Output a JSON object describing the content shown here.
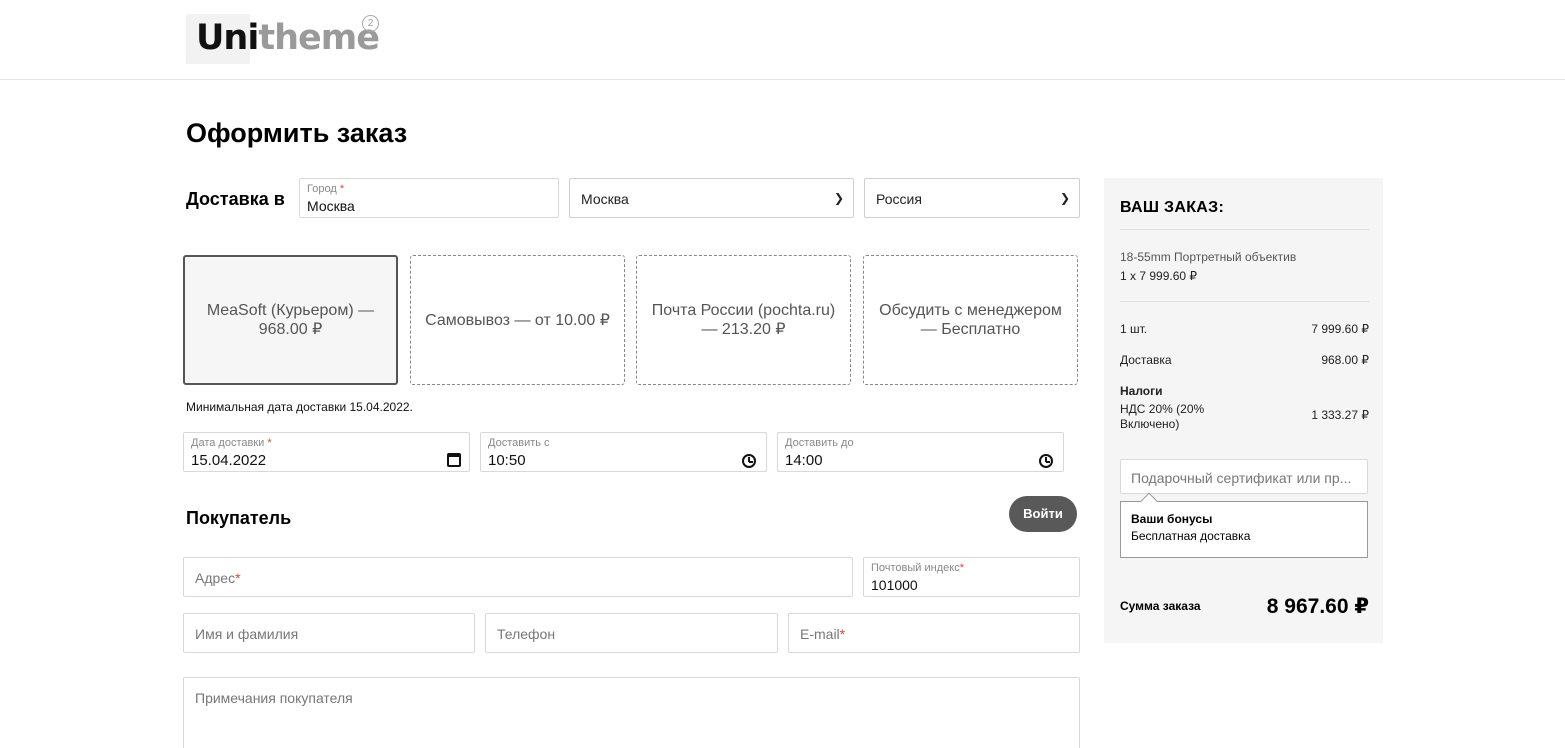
{
  "header": {
    "logo_prefix": "Uni",
    "logo_suffix": "theme",
    "logo_badge": "2"
  },
  "page_title": "Оформить заказ",
  "delivery": {
    "label": "Доставка в",
    "city_label": "Город",
    "city_value": "Москва",
    "region_select": "Москва",
    "country_select": "Россия"
  },
  "shipping_options": [
    {
      "label": "MeaSoft (Курьером) — 968.00 ₽",
      "selected": true
    },
    {
      "label": "Самовывоз — от 10.00 ₽",
      "selected": false
    },
    {
      "label": "Почта России (pochta.ru) — 213.20 ₽",
      "selected": false
    },
    {
      "label": "Обсудить с менеджером — Бесплатно",
      "selected": false
    }
  ],
  "min_delivery_date": "Минимальная дата доставки 15.04.2022.",
  "date_fields": {
    "date_label": "Дата доставки",
    "date_value": "15.04.2022",
    "from_label": "Доставить с",
    "from_value": "10:50",
    "to_label": "Доставить до",
    "to_value": "14:00"
  },
  "buyer": {
    "title": "Покупатель",
    "login_label": "Войти",
    "address_placeholder": "Адрес",
    "postcode_label": "Почтовый индекс",
    "postcode_value": "101000",
    "name_placeholder": "Имя и фамилия",
    "phone_placeholder": "Телефон",
    "email_placeholder": "E-mail",
    "notes_placeholder": "Примечания покупателя"
  },
  "order": {
    "title": "ВАШ ЗАКАЗ:",
    "item_name": "18-55mm Портретный объектив",
    "item_qty_price": "1 x 7 999.60 ₽",
    "qty_label": "1 шт.",
    "qty_total": "7 999.60 ₽",
    "delivery_label": "Доставка",
    "delivery_value": "968.00 ₽",
    "taxes_label": "Налоги",
    "vat_label": "НДС 20% (20% Включено)",
    "vat_value": "1 333.27 ₽",
    "coupon_placeholder": "Подарочный сертификат или пр...",
    "bonus_title": "Ваши бонусы",
    "bonus_text": "Бесплатная доставка",
    "total_label": "Сумма заказа",
    "total_value": "8 967.60 ₽"
  }
}
